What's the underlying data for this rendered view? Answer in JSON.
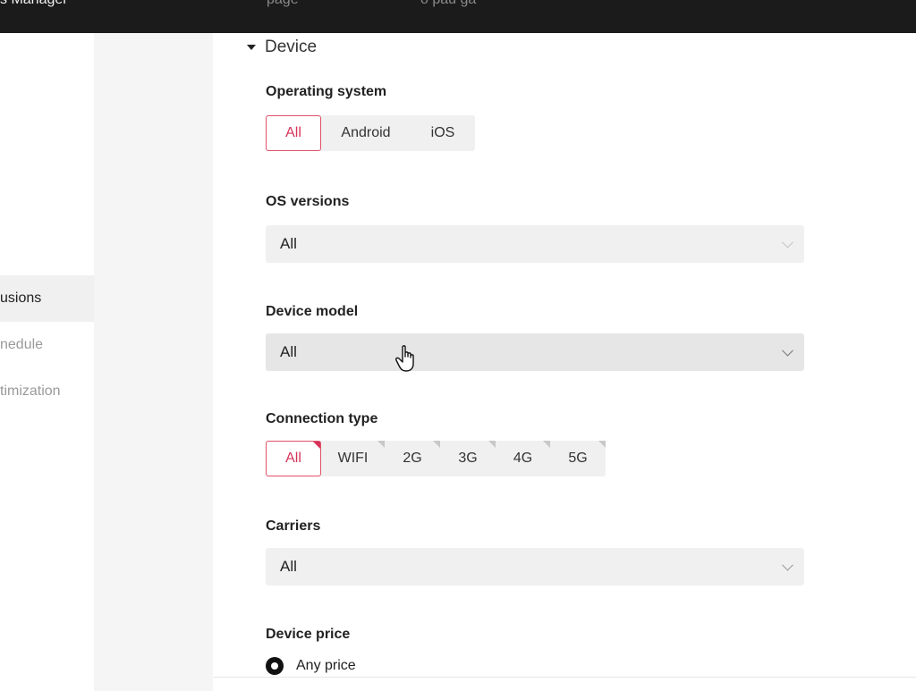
{
  "topbar": {
    "title": "s Manager",
    "faded_left": "page",
    "faded_right": "o  pau ga"
  },
  "sidebar": {
    "items": [
      {
        "label": "usions",
        "active": true
      },
      {
        "label": "nedule",
        "active": false
      },
      {
        "label": "timization",
        "active": false
      }
    ]
  },
  "section": {
    "title": "Device"
  },
  "operating_system": {
    "label": "Operating system",
    "options": [
      "All",
      "Android",
      "iOS"
    ],
    "selected": "All"
  },
  "os_versions": {
    "label": "OS versions",
    "value": "All"
  },
  "device_model": {
    "label": "Device model",
    "value": "All"
  },
  "connection_type": {
    "label": "Connection type",
    "options": [
      "All",
      "WIFI",
      "2G",
      "3G",
      "4G",
      "5G"
    ],
    "selected": "All"
  },
  "carriers": {
    "label": "Carriers",
    "value": "All"
  },
  "device_price": {
    "label": "Device price",
    "option": "Any price"
  },
  "colors": {
    "accent": "#d6335a",
    "topbar": "#1b1b1b"
  }
}
